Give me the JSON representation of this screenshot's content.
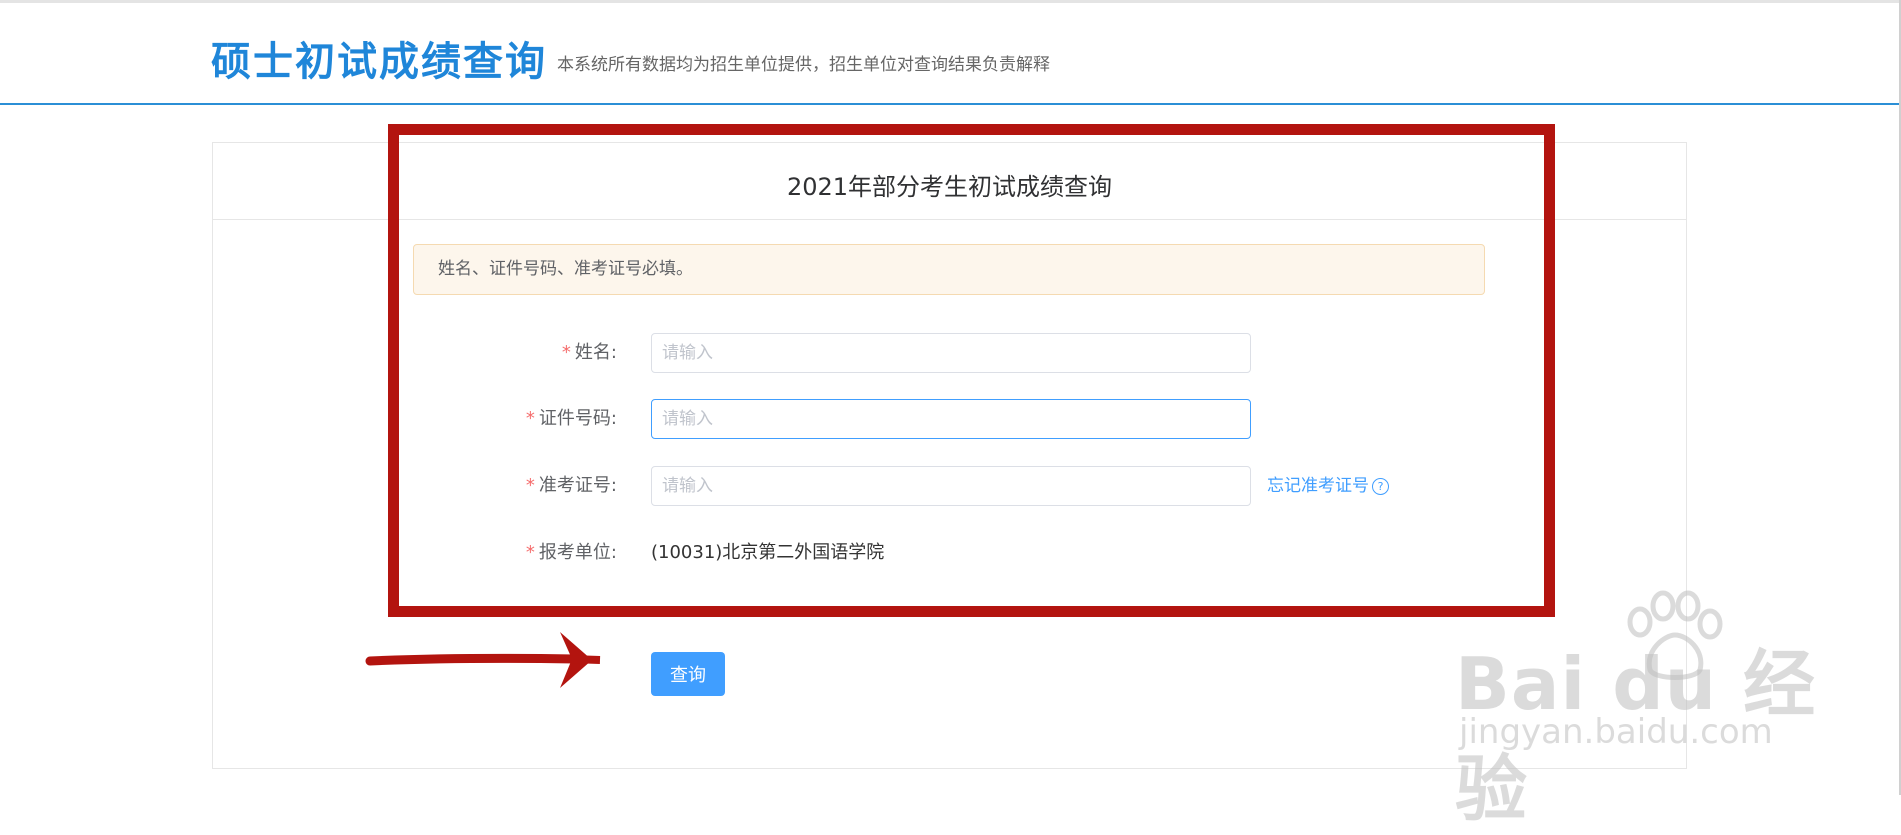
{
  "header": {
    "site_title": "硕士初试成绩查询",
    "notice": "本系统所有数据均为招生单位提供，招生单位对查询结果负责解释"
  },
  "panel": {
    "title": "2021年部分考生初试成绩查询",
    "alert": "姓名、证件号码、准考证号必填。"
  },
  "form": {
    "required_mark": "*",
    "name": {
      "label": "姓名:",
      "placeholder": "请输入",
      "value": ""
    },
    "id_number": {
      "label": "证件号码:",
      "placeholder": "请输入",
      "value": ""
    },
    "ticket_number": {
      "label": "准考证号:",
      "placeholder": "请输入",
      "value": ""
    },
    "forget_link": "忘记准考证号",
    "forget_icon": "?",
    "unit": {
      "label": "报考单位:",
      "value": "(10031)北京第二外国语学院"
    },
    "submit_label": "查询"
  },
  "watermark": {
    "brand": "Bai du 经验",
    "url": "jingyan.baidu.com"
  },
  "colors": {
    "brand_blue": "#1f86d9",
    "primary": "#409eff",
    "annotation_red": "#b3140f",
    "alert_bg": "#fdf6ec"
  }
}
